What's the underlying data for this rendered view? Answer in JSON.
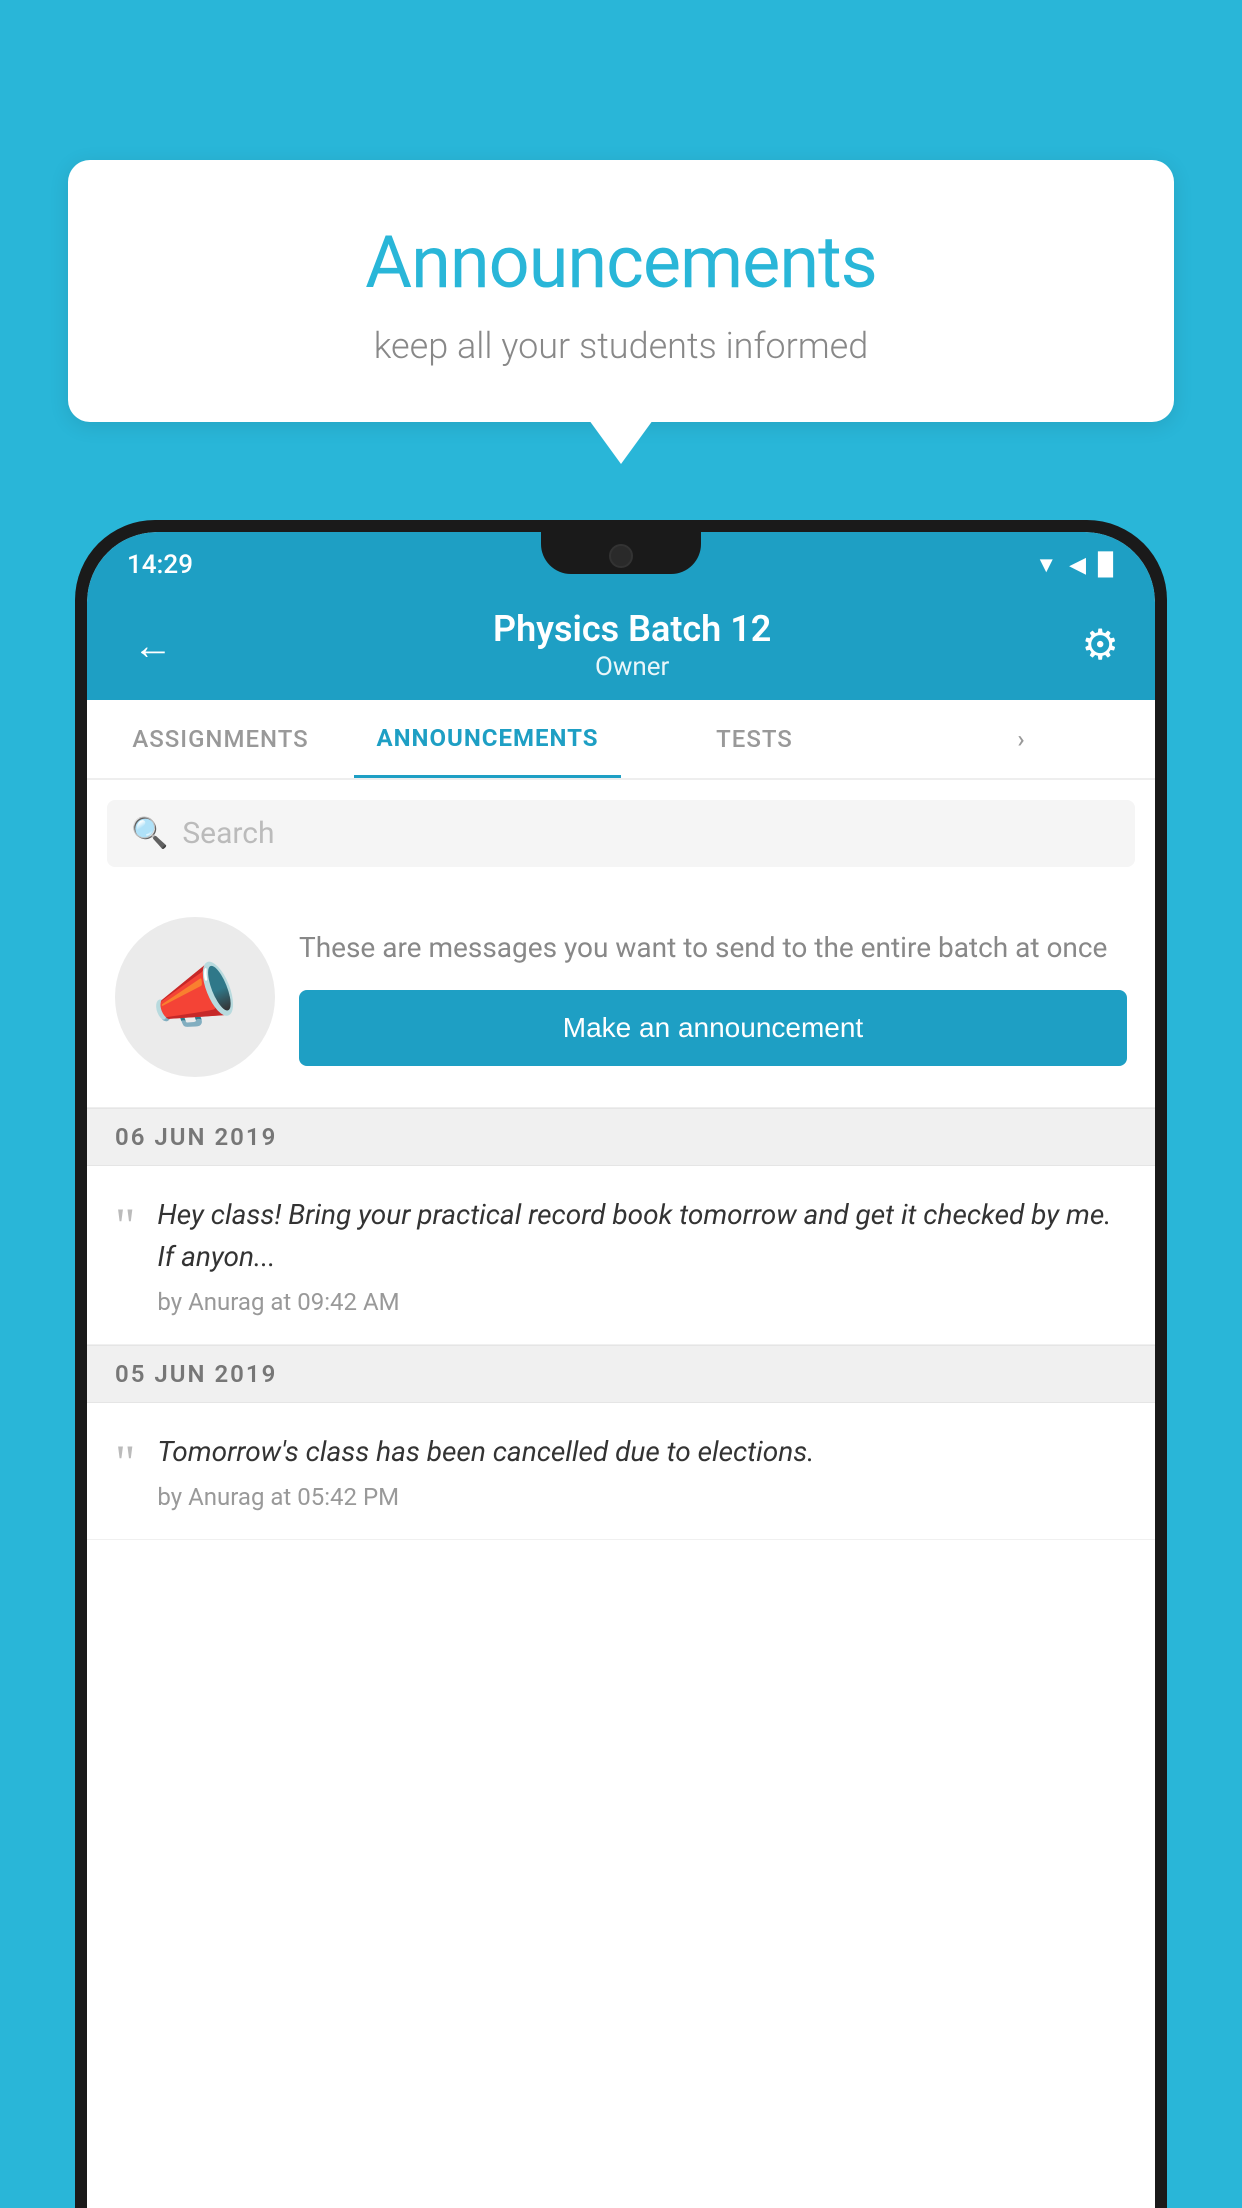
{
  "background": {
    "color": "#29b6d8"
  },
  "speech_bubble": {
    "title": "Announcements",
    "subtitle": "keep all your students informed"
  },
  "status_bar": {
    "time": "14:29",
    "wifi": "▲",
    "signal": "▲",
    "battery": "▉"
  },
  "app_bar": {
    "title": "Physics Batch 12",
    "subtitle": "Owner",
    "back_label": "←"
  },
  "tabs": [
    {
      "label": "ASSIGNMENTS",
      "active": false
    },
    {
      "label": "ANNOUNCEMENTS",
      "active": true
    },
    {
      "label": "TESTS",
      "active": false
    },
    {
      "label": "···",
      "active": false
    }
  ],
  "search": {
    "placeholder": "Search"
  },
  "announcement_prompt": {
    "description": "These are messages you want to send to the entire batch at once",
    "button_label": "Make an announcement"
  },
  "announcements": [
    {
      "date": "06  JUN  2019",
      "items": [
        {
          "text": "Hey class! Bring your practical record book tomorrow and get it checked by me. If anyon...",
          "meta": "by Anurag at 09:42 AM"
        }
      ]
    },
    {
      "date": "05  JUN  2019",
      "items": [
        {
          "text": "Tomorrow's class has been cancelled due to elections.",
          "meta": "by Anurag at 05:42 PM"
        }
      ]
    }
  ]
}
